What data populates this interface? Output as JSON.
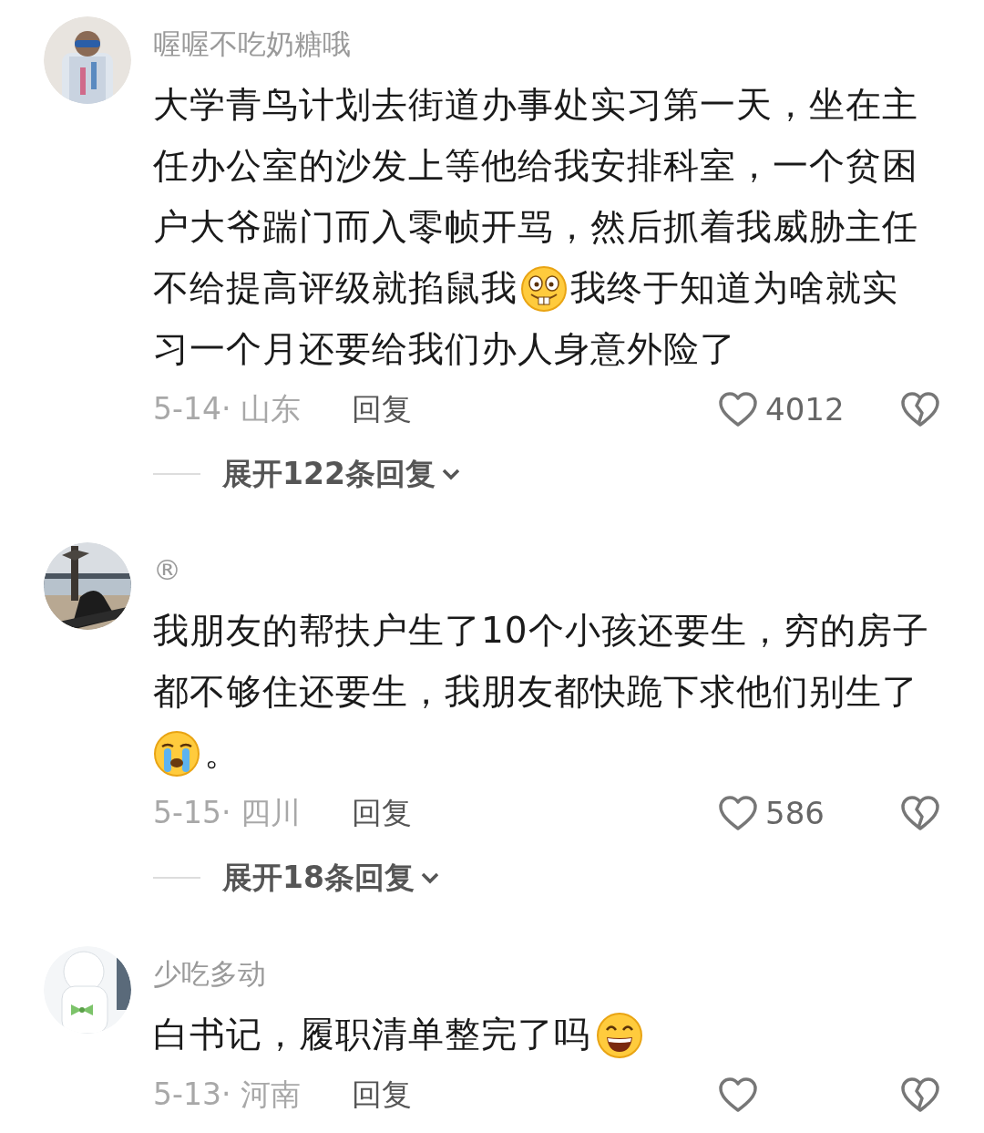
{
  "comments": [
    {
      "avatar": {
        "kind": "picture"
      },
      "username": "喔喔不吃奶糖哦",
      "lines": [
        [
          {
            "kind": "text",
            "text": "大学青鸟计划去街道办事处实习第一天，坐在主"
          }
        ],
        [
          {
            "kind": "text",
            "text": "任办公室的沙发上等他给我安排科室，一个贫困"
          }
        ],
        [
          {
            "kind": "text",
            "text": "户大爷踹门而入零帧开骂，然后抓着我威胁主任"
          }
        ],
        [
          {
            "kind": "text",
            "text": "不给提高评级就掐鼠我"
          },
          {
            "kind": "emoji"
          },
          {
            "kind": "text",
            "text": "我终于知道为啥就实"
          }
        ],
        [
          {
            "kind": "text",
            "text": "习一个月还要给我们办人身意外险了"
          }
        ]
      ],
      "date": "5-14· 山东",
      "reply": "回复",
      "likes": "4012",
      "expand": "展开122条回复"
    },
    {
      "avatar": {
        "kind": "picture"
      },
      "username": "®",
      "lines": [
        [
          {
            "kind": "text",
            "text": "我朋友的帮扶户生了10个小孩还要生，穷的房子"
          }
        ],
        [
          {
            "kind": "text",
            "text": "都不够住还要生，我朋友都快跪下求他们别生了"
          }
        ],
        [
          {
            "kind": "emoji"
          },
          {
            "kind": "text",
            "text": "。"
          }
        ]
      ],
      "date": "5-15· 四川",
      "reply": "回复",
      "likes": "586",
      "expand": "展开18条回复"
    },
    {
      "avatar": {
        "kind": "picture"
      },
      "username": "少吃多动",
      "lines": [
        [
          {
            "kind": "text",
            "text": "白书记，履职清单整完了吗"
          },
          {
            "kind": "emoji"
          }
        ]
      ],
      "date": "5-13· 河南",
      "reply": "回复"
    }
  ]
}
